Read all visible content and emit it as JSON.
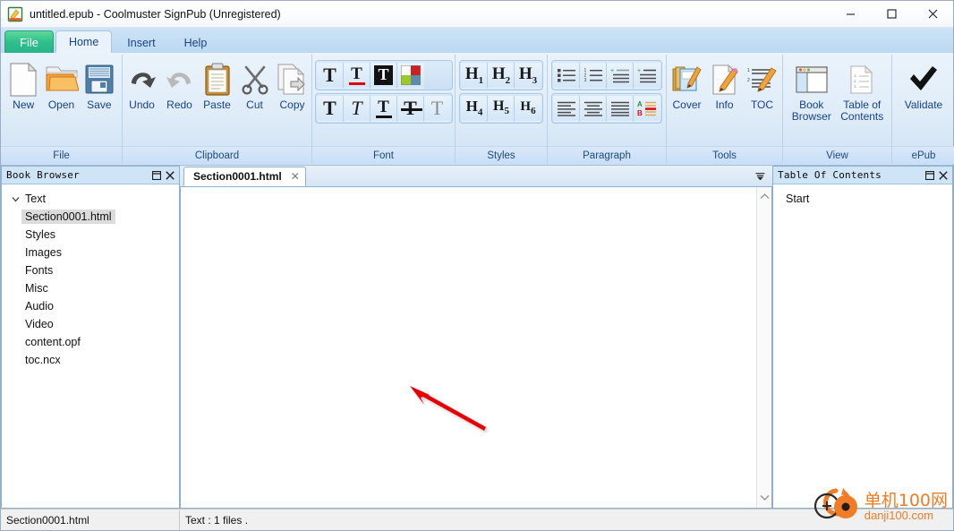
{
  "window": {
    "title": "untitled.epub - Coolmuster SignPub (Unregistered)",
    "icon": "epub-document-icon",
    "controls": [
      {
        "name": "minimize-button",
        "glyph": "—"
      },
      {
        "name": "maximize-button",
        "glyph": "☐"
      },
      {
        "name": "close-button",
        "glyph": "✕"
      }
    ]
  },
  "ribbon": {
    "tabs": [
      {
        "label": "File",
        "type": "file",
        "active": false
      },
      {
        "label": "Home",
        "type": "normal",
        "active": true
      },
      {
        "label": "Insert",
        "type": "normal",
        "active": false
      },
      {
        "label": "Help",
        "type": "normal",
        "active": false
      }
    ],
    "groups": [
      {
        "label": "File",
        "name": "ribbon-group-file",
        "buttons": [
          {
            "label": "New",
            "icon": "new-document-icon"
          },
          {
            "label": "Open",
            "icon": "open-folder-icon"
          },
          {
            "label": "Save",
            "icon": "floppy-save-icon"
          }
        ]
      },
      {
        "label": "Clipboard",
        "name": "ribbon-group-clipboard",
        "buttons": [
          {
            "label": "Undo",
            "icon": "undo-arrow-icon"
          },
          {
            "label": "Redo",
            "icon": "redo-arrow-icon"
          },
          {
            "label": "Paste",
            "icon": "clipboard-paste-icon"
          },
          {
            "label": "Cut",
            "icon": "scissors-cut-icon"
          },
          {
            "label": "Copy",
            "icon": "copy-pages-icon"
          }
        ]
      },
      {
        "label": "Font",
        "name": "ribbon-group-font",
        "row1": [
          {
            "icon": "bold-text-icon",
            "glyph": "T"
          },
          {
            "icon": "underline-text-icon",
            "glyph": "T"
          },
          {
            "icon": "highlight-text-icon",
            "glyph": "T"
          },
          {
            "icon": "text-color-swatch-icon",
            "glyph": ""
          }
        ],
        "row2": [
          {
            "icon": "bold-icon",
            "glyph": "T"
          },
          {
            "icon": "italic-icon",
            "glyph": "T"
          },
          {
            "icon": "underline-icon",
            "glyph": "T"
          },
          {
            "icon": "strikethrough-icon",
            "glyph": "T"
          },
          {
            "icon": "clear-formatting-icon",
            "glyph": "T"
          }
        ]
      },
      {
        "label": "Styles",
        "name": "ribbon-group-styles",
        "row1": [
          {
            "icon": "heading-1-icon",
            "glyph": "H",
            "sub": "1"
          },
          {
            "icon": "heading-2-icon",
            "glyph": "H",
            "sub": "2"
          },
          {
            "icon": "heading-3-icon",
            "glyph": "H",
            "sub": "3"
          }
        ],
        "row2": [
          {
            "icon": "heading-4-icon",
            "glyph": "H",
            "sub": "4"
          },
          {
            "icon": "heading-5-icon",
            "glyph": "H",
            "sub": "5"
          },
          {
            "icon": "heading-6-icon",
            "glyph": "H",
            "sub": "6"
          }
        ]
      },
      {
        "label": "Paragraph",
        "name": "ribbon-group-paragraph",
        "row1": [
          {
            "icon": "bullet-list-icon"
          },
          {
            "icon": "numbered-list-icon"
          },
          {
            "icon": "decrease-indent-icon"
          },
          {
            "icon": "increase-indent-icon"
          }
        ],
        "row2": [
          {
            "icon": "align-left-icon"
          },
          {
            "icon": "align-center-icon"
          },
          {
            "icon": "align-justify-icon"
          },
          {
            "icon": "paragraph-style-icon"
          }
        ]
      },
      {
        "label": "Tools",
        "name": "ribbon-group-tools",
        "buttons": [
          {
            "label": "Cover",
            "icon": "cover-edit-icon"
          },
          {
            "label": "Info",
            "icon": "metadata-info-icon"
          },
          {
            "label": "TOC",
            "icon": "toc-edit-icon"
          }
        ]
      },
      {
        "label": "View",
        "name": "ribbon-group-view",
        "buttons": [
          {
            "label": "Book\nBrowser",
            "line1": "Book",
            "line2": "Browser",
            "icon": "book-browser-panel-icon"
          },
          {
            "label": "Table of Contents",
            "line1": "Table of",
            "line2": "Contents",
            "icon": "table-of-contents-icon"
          }
        ]
      },
      {
        "label": "ePub",
        "name": "ribbon-group-epub",
        "buttons": [
          {
            "label": "Validate",
            "icon": "checkmark-validate-icon"
          }
        ]
      }
    ]
  },
  "left_panel": {
    "title": "Book Browser",
    "header_buttons": [
      {
        "name": "float-panel-button",
        "glyph": "❐"
      },
      {
        "name": "close-panel-button",
        "glyph": "✕"
      }
    ],
    "tree": [
      {
        "label": "Text",
        "level": 0,
        "expandable": true,
        "expanded": true,
        "selected": false
      },
      {
        "label": "Section0001.html",
        "level": 1,
        "expandable": false,
        "expanded": false,
        "selected": true
      },
      {
        "label": "Styles",
        "level": 0,
        "expandable": false,
        "expanded": false,
        "selected": false
      },
      {
        "label": "Images",
        "level": 0,
        "expandable": false,
        "expanded": false,
        "selected": false
      },
      {
        "label": "Fonts",
        "level": 0,
        "expandable": false,
        "expanded": false,
        "selected": false
      },
      {
        "label": "Misc",
        "level": 0,
        "expandable": false,
        "expanded": false,
        "selected": false
      },
      {
        "label": "Audio",
        "level": 0,
        "expandable": false,
        "expanded": false,
        "selected": false
      },
      {
        "label": "Video",
        "level": 0,
        "expandable": false,
        "expanded": false,
        "selected": false
      },
      {
        "label": "content.opf",
        "level": 0,
        "expandable": false,
        "expanded": false,
        "selected": false
      },
      {
        "label": "toc.ncx",
        "level": 0,
        "expandable": false,
        "expanded": false,
        "selected": false
      }
    ]
  },
  "center": {
    "tabs": [
      {
        "label": "Section0001.html",
        "close_glyph": "✕",
        "active": true
      }
    ],
    "tab_menu_glyph": "▼",
    "editor_content": "",
    "scrollbar": {
      "up_glyph": "⌃",
      "down_glyph": "⌄"
    },
    "annotation": {
      "type": "red-arrow",
      "color": "#e80000"
    }
  },
  "right_panel": {
    "title": "Table Of Contents",
    "header_buttons": [
      {
        "name": "float-panel-button",
        "glyph": "❐"
      },
      {
        "name": "close-panel-button",
        "glyph": "✕"
      }
    ],
    "items": [
      {
        "label": "Start"
      }
    ]
  },
  "statusbar": {
    "left": "Section0001.html",
    "right": "Text : 1 files ."
  },
  "watermark": {
    "cn": "单机100网",
    "en": "danji100.com",
    "color": "#f07c25"
  },
  "colors": {
    "file_tab": "#2ec08a",
    "ribbon_text": "#15428b",
    "panel_header": "#cfe4f7",
    "accent": "#e80000"
  }
}
